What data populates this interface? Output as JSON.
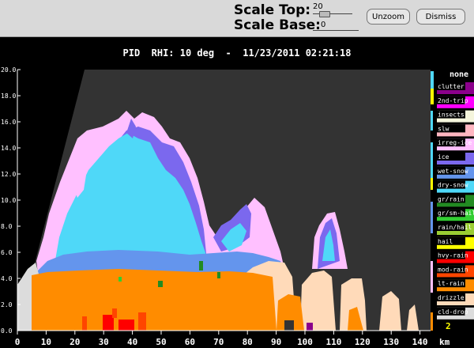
{
  "controls": {
    "scale_top_label": "Scale Top:",
    "scale_top_value": "20",
    "scale_base_label": "Scale Base:",
    "scale_base_value": "0",
    "unzoom_label": "Unzoom",
    "dismiss_label": "Dismiss"
  },
  "plot_title": "PID  RHI: 10 deg  -  11/23/2011 02:21:18",
  "axes": {
    "x_ticks": [
      "0",
      "10",
      "20",
      "30",
      "40",
      "50",
      "60",
      "70",
      "80",
      "90",
      "100",
      "110",
      "120",
      "130",
      "140"
    ],
    "x_unit": "km",
    "y_ticks": [
      "0.0",
      "2.0",
      "4.0",
      "6.0",
      "8.0",
      "10.0",
      "12.0",
      "14.0",
      "16.0",
      "18.0",
      "20.0"
    ]
  },
  "legend": {
    "title": "none",
    "items": [
      {
        "label": "clutter",
        "color": "#8b008b"
      },
      {
        "label": "2nd-trip",
        "color": "#ff00ff"
      },
      {
        "label": "insects",
        "color": "#f5f5dc"
      },
      {
        "label": "slw",
        "color": "#ffb6c1"
      },
      {
        "label": "irreg-ice",
        "color": "#ffc0ff"
      },
      {
        "label": "ice",
        "color": "#7b68ee"
      },
      {
        "label": "wet-snow",
        "color": "#6495ed"
      },
      {
        "label": "dry-snow",
        "color": "#4fd8f8"
      },
      {
        "label": "gr/rain",
        "color": "#228b22"
      },
      {
        "label": "gr/sm-hail",
        "color": "#32cd32"
      },
      {
        "label": "rain/hail",
        "color": "#9acd32"
      },
      {
        "label": "hail",
        "color": "#ffff00"
      },
      {
        "label": "hvy-rain",
        "color": "#ff0000"
      },
      {
        "label": "mod-rain",
        "color": "#ff4500"
      },
      {
        "label": "lt-rain",
        "color": "#ff8c00"
      },
      {
        "label": "drizzle",
        "color": "#ffdab9"
      },
      {
        "label": "cld-drop",
        "color": "#dcdcdc"
      }
    ],
    "marker_number": "2"
  },
  "colors": {
    "background": "#000000",
    "plot_background": "#333333",
    "toolbar": "#d9d9d9",
    "axis": "#ffffff"
  }
}
